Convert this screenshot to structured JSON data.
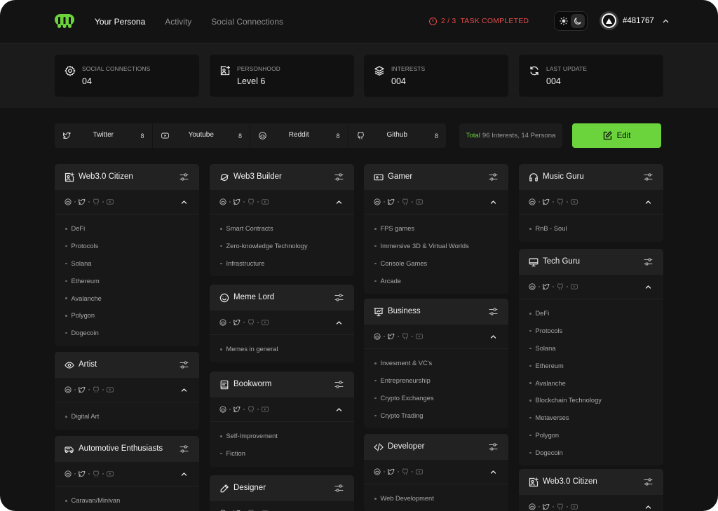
{
  "nav": {
    "items": [
      "Your Persona",
      "Activity",
      "Social Connections"
    ],
    "active": "Your Persona"
  },
  "task": {
    "text": "2 / 3  TASK COMPLETED",
    "color": "#e44b4b"
  },
  "user": {
    "id": "#481767"
  },
  "colors": {
    "accent": "#6bd33b",
    "background": "#131313",
    "alert": "#e44b4b"
  },
  "stats": [
    {
      "icon": "gear-icon",
      "label": "SOCIAL CONNECTIONS",
      "value": "04"
    },
    {
      "icon": "id-card-icon",
      "label": "PERSONHOOD",
      "value": "Level 6"
    },
    {
      "icon": "layers-icon",
      "label": "INTERESTS",
      "value": "004"
    },
    {
      "icon": "refresh-icon",
      "label": "LAST UPDATE",
      "value": "004"
    }
  ],
  "filters": [
    {
      "icon": "twitter-icon",
      "name": "Twitter",
      "count": "8"
    },
    {
      "icon": "youtube-icon",
      "name": "Youtube",
      "count": "8"
    },
    {
      "icon": "reddit-icon",
      "name": "Reddit",
      "count": "8"
    },
    {
      "icon": "github-icon",
      "name": "Github",
      "count": "8"
    }
  ],
  "total": {
    "label": "Total",
    "text": "96 Interests, 14 Persona"
  },
  "edit": {
    "label": "Edit"
  },
  "cards": [
    {
      "icon": "id-card-icon",
      "title": "Web3.0 Citizen",
      "items": [
        "DeFi",
        "Protocols",
        "Solana",
        "Ethereum",
        "Avalanche",
        "Polygon",
        "Dogecoin"
      ]
    },
    {
      "icon": "eye-icon",
      "title": "Artist",
      "items": [
        "Digital Art"
      ]
    },
    {
      "icon": "car-icon",
      "title": "Automotive Enthusiasts",
      "items": [
        "Caravan/Minivan"
      ]
    },
    {
      "icon": "planet-icon",
      "title": "Web3 Builder",
      "items": [
        "Smart Contracts",
        "Zero-knowledge Technology",
        "Infrastructure"
      ]
    },
    {
      "icon": "smile-icon",
      "title": "Meme Lord",
      "items": [
        "Memes in general"
      ]
    },
    {
      "icon": "book-icon",
      "title": "Bookworm",
      "items": [
        "Self-Improvement",
        "Fiction"
      ]
    },
    {
      "icon": "pen-icon",
      "title": "Designer",
      "items": []
    },
    {
      "icon": "gamepad-icon",
      "title": "Gamer",
      "items": [
        "FPS games",
        "Immersive 3D & Virtual Worlds",
        "Console Games",
        "Arcade"
      ]
    },
    {
      "icon": "presentation-icon",
      "title": "Business",
      "items": [
        "Invesment & VC's",
        "Entrepreneurship",
        "Crypto Exchanges",
        "Crypto Trading"
      ]
    },
    {
      "icon": "code-icon",
      "title": "Developer",
      "items": [
        "Web Development"
      ]
    },
    {
      "icon": "headphones-icon",
      "title": "Music Guru",
      "items": [
        "RnB - Soul"
      ]
    },
    {
      "icon": "monitor-icon",
      "title": "Tech Guru",
      "items": [
        "DeFi",
        "Protocols",
        "Solana",
        "Ethereum",
        "Avalanche",
        "Blockchain Technology",
        "Metaverses",
        "Polygon",
        "Dogecoin"
      ]
    },
    {
      "icon": "id-card-icon",
      "title": "Web3.0 Citizen",
      "items": []
    }
  ]
}
